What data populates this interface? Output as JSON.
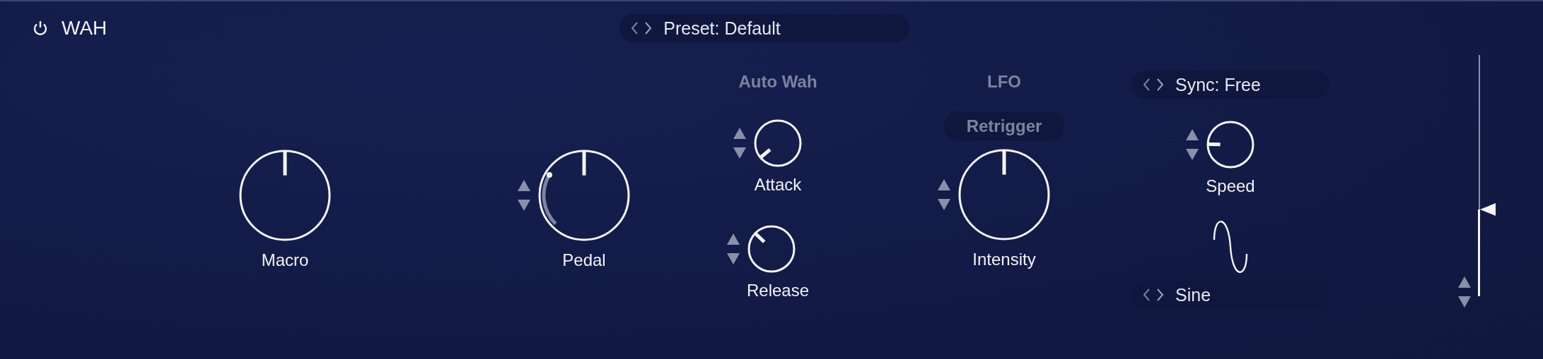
{
  "header": {
    "power": {
      "on": true
    },
    "title": "WAH",
    "preset": {
      "label": "Preset: Default"
    }
  },
  "macro": {
    "label": "Macro"
  },
  "pedal": {
    "label": "Pedal"
  },
  "auto_wah": {
    "title": "Auto Wah",
    "knobs": [
      {
        "label": "Attack"
      },
      {
        "label": "Release"
      }
    ]
  },
  "lfo": {
    "title": "LFO",
    "retrigger": {
      "label": "Retrigger",
      "on": false
    },
    "intensity": {
      "label": "Intensity"
    },
    "sync": {
      "label": "Sync: Free"
    },
    "speed": {
      "label": "Speed"
    },
    "shape": {
      "kind": "sine",
      "label": "Sine"
    }
  },
  "output_slider": {
    "level": 0.36
  }
}
